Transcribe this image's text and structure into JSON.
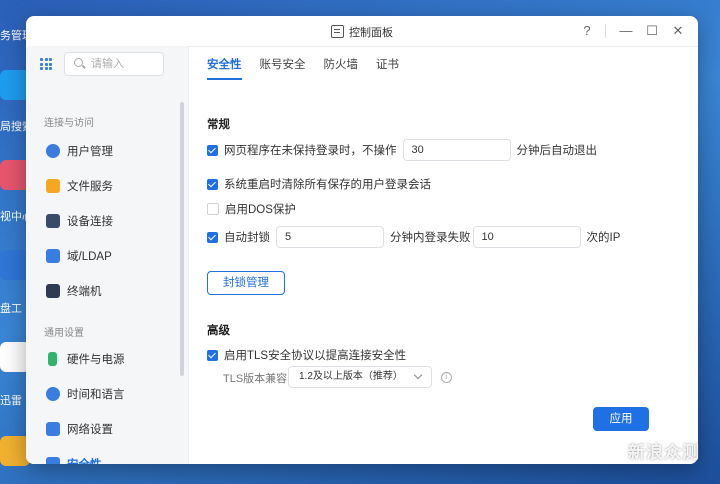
{
  "desktop": {
    "labels": [
      "务管理",
      "局搜索",
      "视中心",
      "盘工",
      "迅雷"
    ]
  },
  "window": {
    "title": "控制面板",
    "help": "?",
    "minimize": "—",
    "maximize": "☐",
    "close": "✕"
  },
  "sidebar": {
    "search_placeholder": "请输入",
    "section1": "连接与访问",
    "section2": "通用设置",
    "items": [
      {
        "label": "用户管理",
        "icon": "user-icon",
        "color": "#3a7de0"
      },
      {
        "label": "文件服务",
        "icon": "folder-icon",
        "color": "#f5a623"
      },
      {
        "label": "设备连接",
        "icon": "device-icon",
        "color": "#3a4a6b"
      },
      {
        "label": "域/LDAP",
        "icon": "domain-icon",
        "color": "#3a7de0"
      },
      {
        "label": "终端机",
        "icon": "terminal-icon",
        "color": "#2f3b52"
      },
      {
        "label": "硬件与电源",
        "icon": "battery-icon",
        "color": "#2fb36d"
      },
      {
        "label": "时间和语言",
        "icon": "globe-icon",
        "color": "#3a7de0"
      },
      {
        "label": "网络设置",
        "icon": "network-icon",
        "color": "#3a7de0"
      },
      {
        "label": "安全性",
        "icon": "shield-icon",
        "color": "#3a7de0"
      }
    ]
  },
  "tabs": [
    "安全性",
    "账号安全",
    "防火墙",
    "证书"
  ],
  "general": {
    "heading": "常规",
    "timeout_prefix": "网页程序在未保持登录时，不操作",
    "timeout_value": "30",
    "timeout_suffix": "分钟后自动退出",
    "clear_sessions": "系统重启时清除所有保存的用户登录会话",
    "dos": "启用DOS保护",
    "autoblock": "自动封锁",
    "block_minutes": "5",
    "block_mid": "分钟内登录失败",
    "block_count": "10",
    "block_suffix": "次的IP",
    "block_manage": "封锁管理"
  },
  "advanced": {
    "heading": "高级",
    "tls_enable": "启用TLS安全协议以提高连接安全性",
    "tls_label": "TLS版本兼容",
    "tls_value": "1.2及以上版本（推荐）"
  },
  "apply": "应用",
  "watermark": "新浪众测"
}
